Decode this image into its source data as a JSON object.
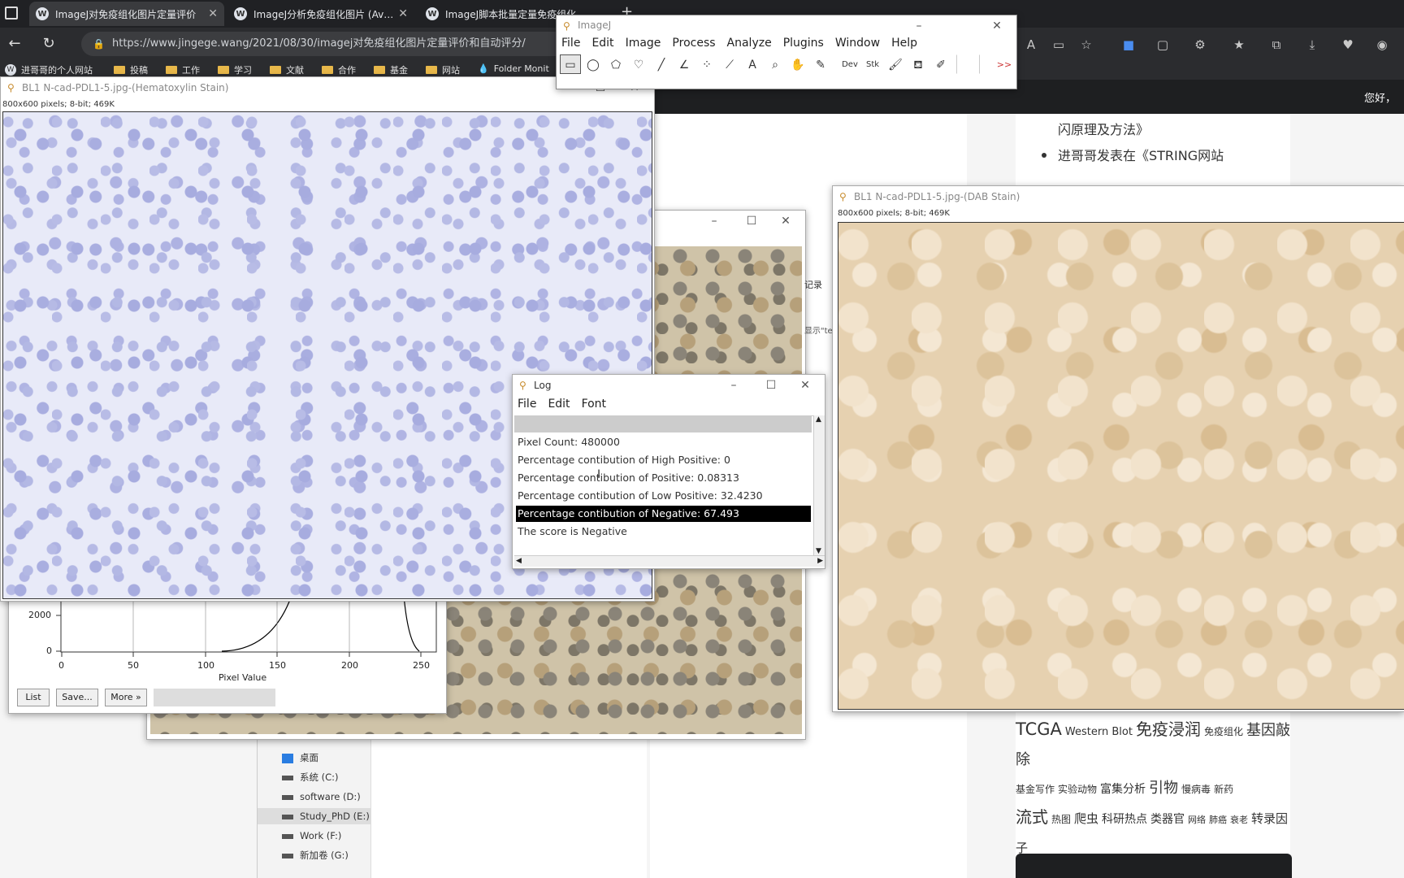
{
  "browser": {
    "tabs": [
      {
        "title": "ImageJ对免疫组化图片定量评价"
      },
      {
        "title": "ImageJ分析免疫组化图片 (Aver"
      },
      {
        "title": "ImageJ脚本批量定量免疫组化"
      }
    ],
    "new_tab": "+",
    "url": "https://www.jingege.wang/2021/08/30/imagej对免疫组化图片定量评价和自动评分/",
    "bookmarks": [
      "进哥哥的个人网站",
      "投稿",
      "工作",
      "学习",
      "文献",
      "合作",
      "基金",
      "网站",
      "Folder Monit"
    ]
  },
  "page": {
    "greeting": "您好，",
    "sidebar_lines": [
      "闪原理及方法》",
      "进哥哥发表在《STRING网站"
    ],
    "side_label_1": "记录",
    "side_label_2": "显示\"te"
  },
  "imagej": {
    "title": "ImageJ",
    "menu": [
      "File",
      "Edit",
      "Image",
      "Process",
      "Analyze",
      "Plugins",
      "Window",
      "Help"
    ],
    "tools": [
      "rectangle",
      "oval",
      "polygon",
      "freehand",
      "line",
      "angle",
      "multipoint",
      "wand",
      "text",
      "magnifier",
      "hand",
      "dropper",
      "Dev",
      "Stk",
      "brush",
      "flood-fill",
      "pencil",
      "",
      "",
      "more"
    ],
    "tool_labels": {
      "dev": "Dev",
      "stk": "Stk",
      "more": ">>",
      "text": "A"
    }
  },
  "hema_window": {
    "title": "BL1 N-cad-PDL1-5.jpg-(Hematoxylin Stain)",
    "info": "800x600 pixels; 8-bit; 469K"
  },
  "dab_window": {
    "title": "BL1 N-cad-PDL1-5.jpg-(DAB Stain)",
    "info": "800x600 pixels; 8-bit; 469K"
  },
  "log_window": {
    "title": "Log",
    "menu": [
      "File",
      "Edit",
      "Font"
    ],
    "lines": [
      "",
      "Pixel Count: 480000",
      "Percentage contibution of High Positive:  0",
      "Percentage contibution of Positive:  0.08313",
      "Percentage contibution of Low Positive:  32.4230",
      "Percentage contibution of Negative:  67.493",
      "The score is Negative"
    ],
    "highlighted_line": 5
  },
  "histogram": {
    "yticks": [
      "2000",
      "0"
    ],
    "xticks": [
      "0",
      "50",
      "100",
      "150",
      "200",
      "250"
    ],
    "xlabel": "Pixel Value",
    "buttons": [
      "List",
      "Save...",
      "More »"
    ]
  },
  "explorer": {
    "items": [
      "桌面",
      "系统 (C:)",
      "software (D:)",
      "Study_PhD (E:)",
      "Work (F:)",
      "新加卷 (G:)"
    ],
    "selected": 3
  },
  "tags": [
    "TCGA",
    "Western Blot",
    "免疫浸润",
    "免疫组化",
    "基因敲除",
    "基金写作",
    "实验动物",
    "富集分析",
    "引物",
    "慢病毒",
    "新药",
    "流式",
    "热图",
    "爬虫",
    "科研热点",
    "类器官",
    "网络",
    "肺癌",
    "衰老",
    "转录因子"
  ]
}
